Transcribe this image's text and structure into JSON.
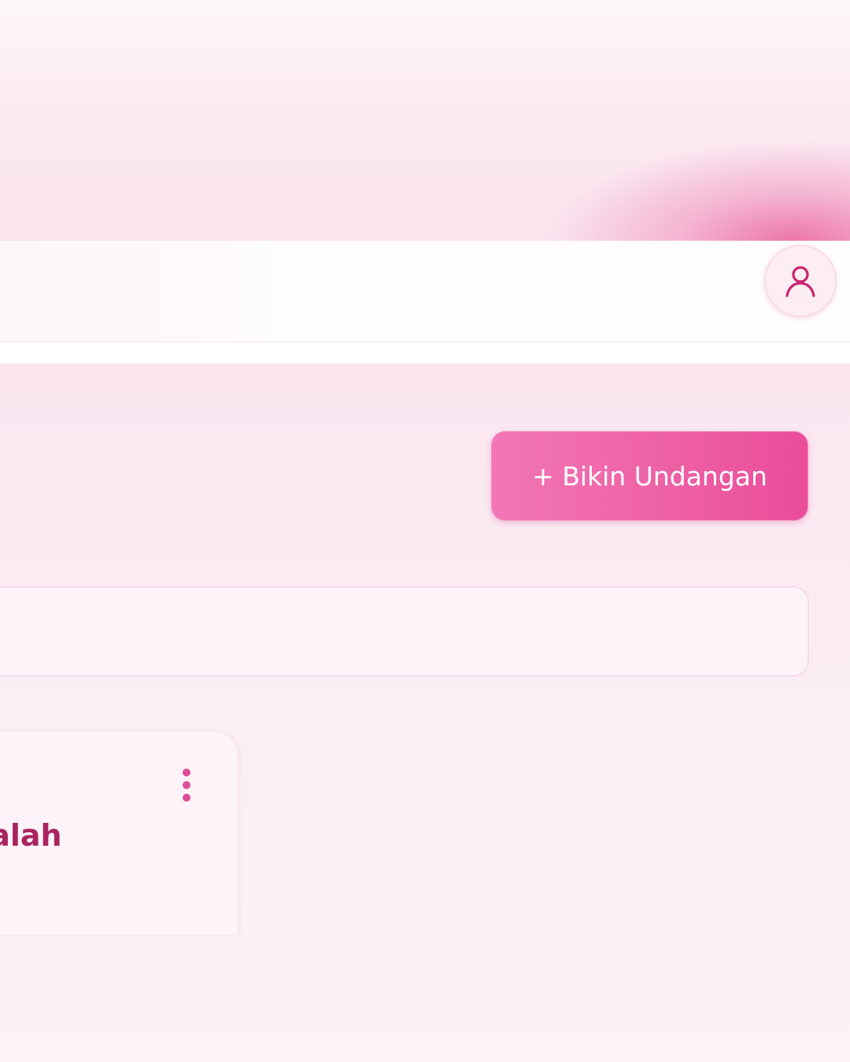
{
  "header": {
    "account_icon": "user-icon"
  },
  "actions": {
    "create_label": "+ Bikin Undangan"
  },
  "search": {
    "value": "",
    "placeholder": ""
  },
  "cards": [
    {
      "title_visible": "dalah",
      "menu_icon": "kebab-menu-icon"
    }
  ],
  "colors": {
    "accent": "#ec5aa2",
    "title": "#a9245f",
    "background": "#fbe9f1"
  }
}
